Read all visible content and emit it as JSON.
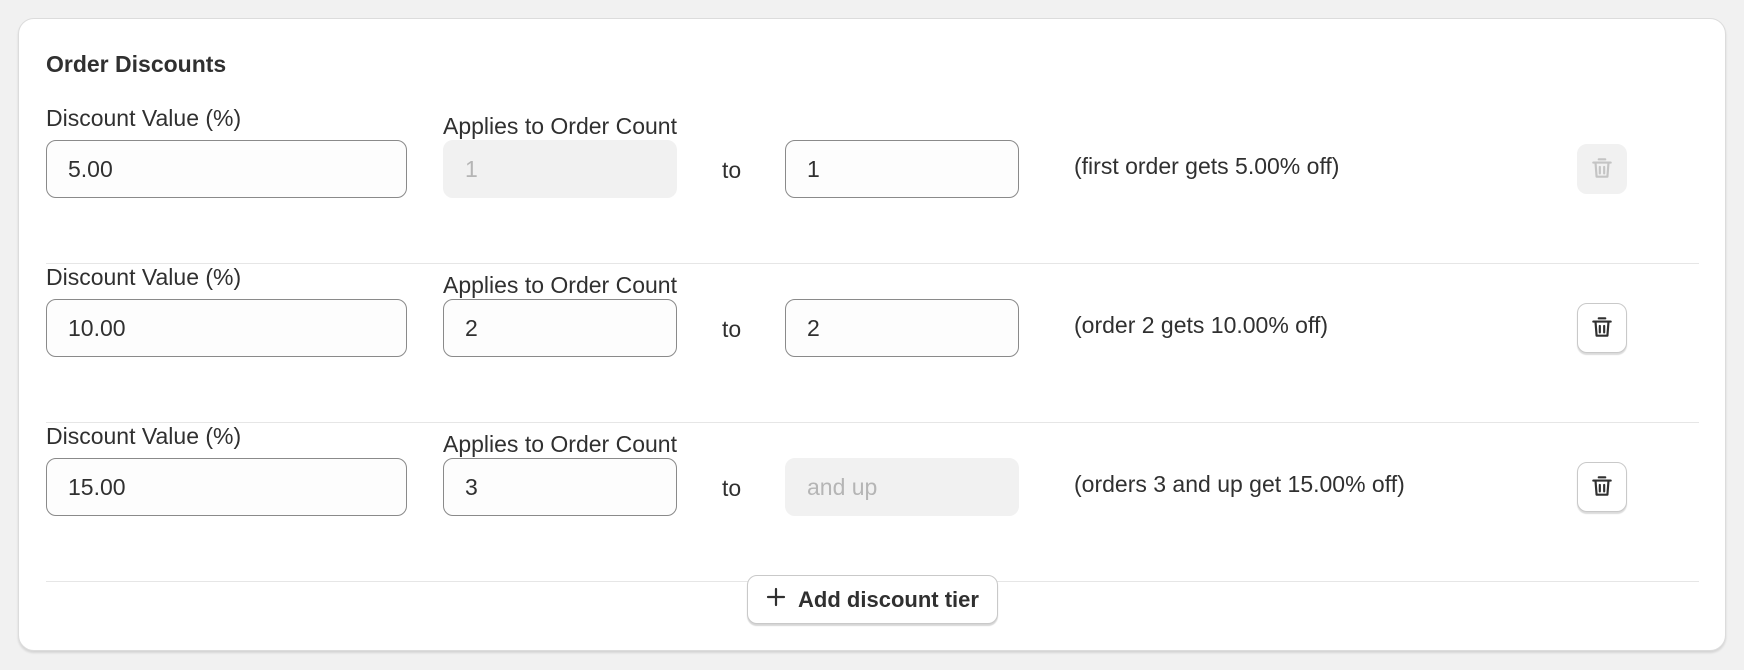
{
  "section": {
    "title": "Order Discounts",
    "add_button_label": "Add discount tier"
  },
  "labels": {
    "discount_value": "Discount Value (%)",
    "order_count": "Applies to Order Count",
    "to": "to"
  },
  "tiers": [
    {
      "value": "5.00",
      "from": "1",
      "from_disabled": true,
      "to": "1",
      "to_placeholder": "",
      "to_disabled": false,
      "summary": "(first order gets 5.00% off)",
      "delete_disabled": true
    },
    {
      "value": "10.00",
      "from": "2",
      "from_disabled": false,
      "to": "2",
      "to_placeholder": "",
      "to_disabled": false,
      "summary": "(order 2 gets 10.00% off)",
      "delete_disabled": false
    },
    {
      "value": "15.00",
      "from": "3",
      "from_disabled": false,
      "to": "",
      "to_placeholder": "and up",
      "to_disabled": true,
      "summary": "(orders 3 and up get 15.00% off)",
      "delete_disabled": false
    }
  ],
  "icons": {
    "delete": "trash-icon",
    "add": "plus-icon"
  },
  "colors": {
    "text": "#303030",
    "disabled_text": "#b5b5b5",
    "disabled_bg": "#f1f1f1",
    "border": "#8a8a8a"
  }
}
